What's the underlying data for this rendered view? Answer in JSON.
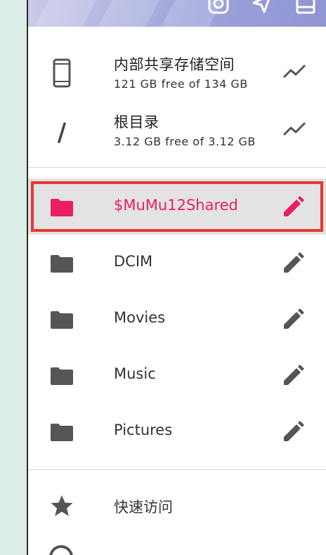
{
  "colors": {
    "accent": "#e91e63",
    "icon": "#555555",
    "highlight_border": "#e53935",
    "selected_bg": "#e3e3e3"
  },
  "header": {
    "icons": [
      "instagram-icon",
      "send-icon",
      "window-icon"
    ]
  },
  "storage": [
    {
      "icon": "phone-icon",
      "title": "内部共享存储空间",
      "subtitle": "121 GB free of 134 GB",
      "action_icon": "trend-icon"
    },
    {
      "icon": "slash-icon",
      "title": "根目录",
      "subtitle": "3.12 GB free of 3.12 GB",
      "action_icon": "trend-icon"
    }
  ],
  "folders": [
    {
      "label": "$MuMu12Shared",
      "selected": true,
      "action_icon": "pencil-icon"
    },
    {
      "label": "DCIM",
      "selected": false,
      "action_icon": "pencil-icon"
    },
    {
      "label": "Movies",
      "selected": false,
      "action_icon": "pencil-icon"
    },
    {
      "label": "Music",
      "selected": false,
      "action_icon": "pencil-icon"
    },
    {
      "label": "Pictures",
      "selected": false,
      "action_icon": "pencil-icon"
    }
  ],
  "quick_access": {
    "icon": "star-icon",
    "label": "快速访问"
  }
}
